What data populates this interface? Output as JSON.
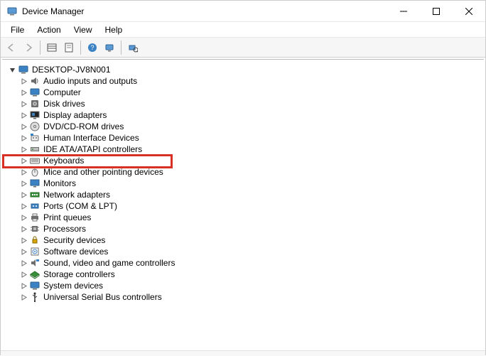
{
  "window": {
    "title": "Device Manager"
  },
  "menu": {
    "items": [
      "File",
      "Action",
      "View",
      "Help"
    ]
  },
  "toolbar": {
    "buttons": [
      {
        "name": "back",
        "enabled": false
      },
      {
        "name": "forward",
        "enabled": false
      },
      {
        "name": "sep"
      },
      {
        "name": "show-hidden",
        "enabled": true
      },
      {
        "name": "properties",
        "enabled": true
      },
      {
        "name": "sep"
      },
      {
        "name": "help",
        "enabled": true
      },
      {
        "name": "computer-icon-btn",
        "enabled": true
      },
      {
        "name": "sep"
      },
      {
        "name": "scan-hardware",
        "enabled": true
      }
    ]
  },
  "tree": {
    "root": {
      "label": "DESKTOP-JV8N001",
      "icon": "computer",
      "expanded": true
    },
    "categories": [
      {
        "label": "Audio inputs and outputs",
        "icon": "audio"
      },
      {
        "label": "Computer",
        "icon": "computer"
      },
      {
        "label": "Disk drives",
        "icon": "disk"
      },
      {
        "label": "Display adapters",
        "icon": "display"
      },
      {
        "label": "DVD/CD-ROM drives",
        "icon": "disc"
      },
      {
        "label": "Human Interface Devices",
        "icon": "hid"
      },
      {
        "label": "IDE ATA/ATAPI controllers",
        "icon": "ide"
      },
      {
        "label": "Keyboards",
        "icon": "keyboard",
        "highlighted": true
      },
      {
        "label": "Mice and other pointing devices",
        "icon": "mouse"
      },
      {
        "label": "Monitors",
        "icon": "monitor"
      },
      {
        "label": "Network adapters",
        "icon": "network"
      },
      {
        "label": "Ports (COM & LPT)",
        "icon": "ports"
      },
      {
        "label": "Print queues",
        "icon": "printer"
      },
      {
        "label": "Processors",
        "icon": "cpu"
      },
      {
        "label": "Security devices",
        "icon": "security"
      },
      {
        "label": "Software devices",
        "icon": "software"
      },
      {
        "label": "Sound, video and game controllers",
        "icon": "soundvideo"
      },
      {
        "label": "Storage controllers",
        "icon": "storage"
      },
      {
        "label": "System devices",
        "icon": "system"
      },
      {
        "label": "Universal Serial Bus controllers",
        "icon": "usb"
      }
    ]
  },
  "colors": {
    "highlight_border": "#d93025",
    "caret": "#6b6b6b",
    "icon_blue": "#3b82c4",
    "icon_gray": "#6e6e6e",
    "icon_green": "#3a8f3a",
    "icon_yellow": "#d9a300"
  }
}
